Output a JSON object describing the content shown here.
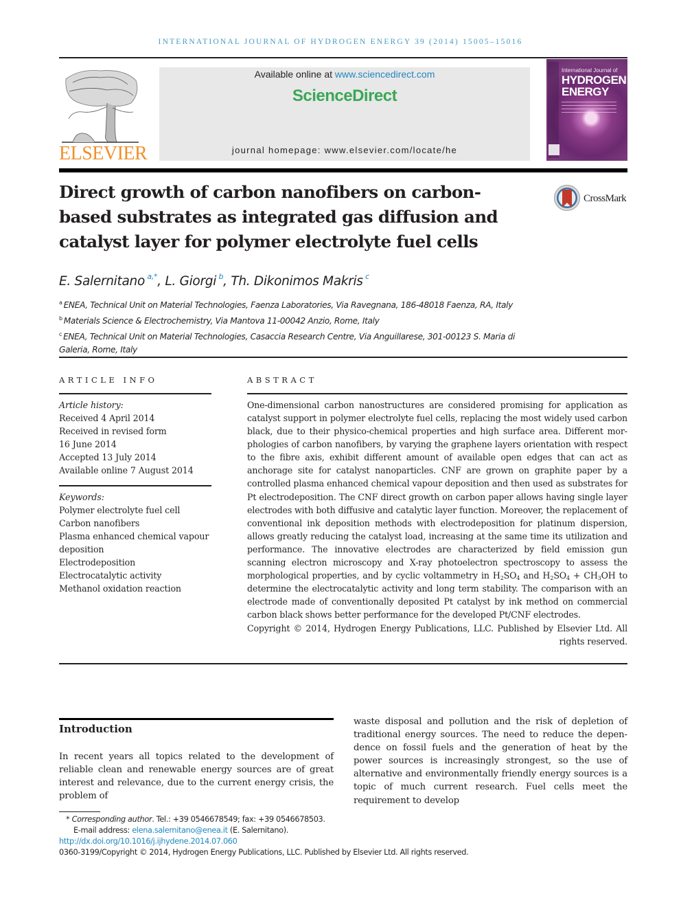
{
  "running_head": "INTERNATIONAL JOURNAL OF HYDROGEN ENERGY 39 (2014) 15005–15016",
  "header": {
    "publisher_name": "ELSEVIER",
    "available_online_prefix": "Available online at ",
    "available_online_link": "www.sciencedirect.com",
    "brand": "ScienceDirect",
    "journal_homepage": "journal homepage: www.elsevier.com/locate/he",
    "cover": {
      "line1": "International Journal of",
      "line2": "HYDROGEN",
      "line3": "ENERGY"
    }
  },
  "colors": {
    "link_blue": "#1f87c0",
    "running_head_blue": "#4a9bc0",
    "sciencedirect_green": "#3aa757",
    "elsevier_orange": "#f0902a"
  },
  "article": {
    "title": "Direct growth of carbon nanofibers on carbon-based substrates as integrated gas diffusion and catalyst layer for polymer electrolyte fuel cells",
    "crossmark_label": "CrossMark",
    "authors": [
      {
        "name": "E. Salernitano",
        "marks": "a,*"
      },
      {
        "name": "L. Giorgi",
        "marks": "b"
      },
      {
        "name": "Th. Dikonimos Makris",
        "marks": "c"
      }
    ],
    "affiliations": [
      {
        "mark": "a",
        "text": "ENEA, Technical Unit on Material Technologies, Faenza Laboratories, Via Ravegnana, 186-48018 Faenza, RA, Italy"
      },
      {
        "mark": "b",
        "text": "Materials Science & Electrochemistry, Via Mantova 11-00042 Anzio, Rome, Italy"
      },
      {
        "mark": "c",
        "text": "ENEA, Technical Unit on Material Technologies, Casaccia Research Centre, Via Anguillarese, 301-00123 S. Maria di Galeria, Rome, Italy"
      }
    ]
  },
  "article_info": {
    "heading": "ARTICLE INFO",
    "history_label": "Article history:",
    "history": [
      "Received 4 April 2014",
      "Received in revised form",
      "16 June 2014",
      "Accepted 13 July 2014",
      "Available online 7 August 2014"
    ],
    "keywords_label": "Keywords:",
    "keywords": [
      "Polymer electrolyte fuel cell",
      "Carbon nanofibers",
      "Plasma enhanced chemical vapour deposition",
      "Electrodeposition",
      "Electrocatalytic activity",
      "Methanol oxidation reaction"
    ]
  },
  "abstract": {
    "heading": "ABSTRACT",
    "part1": "One-dimensional carbon nanostructures are considered promising for application as catalyst support in polymer electrolyte fuel cells, replacing the most widely used carbon black, due to their physico-chemical properties and high surface area. Different mor­phologies of carbon nanofibers, by varying the graphene layers orientation with respect to the fibre axis, exhibit different amount of available open edges that can act as anchorage site for catalyst nanoparticles. CNF are grown on graphite paper by a controlled plasma enhanced chemical vapour deposition and then used as substrates for Pt electrodeposition. The CNF direct growth on carbon paper allows having single layer electrodes with both diffusive and catalytic layer function. Moreover, the replacement of conventional ink deposition methods with electrodeposition for platinum dispersion, allows greatly reducing the catalyst load, increasing at the same time its utilization and performance. The innovative electrodes are characterized by field emission gun scanning electron micro­scopy and X-ray photoelectron spectroscopy to assess the morphological properties, and by cyclic voltammetry in ",
    "formula1": {
      "a": "H",
      "a_sub": "2",
      "b": "SO",
      "b_sub": "4"
    },
    "part2": " and ",
    "formula2": {
      "a": "H",
      "a_sub": "2",
      "b": "SO",
      "b_sub": "4",
      "plus": " + CH",
      "c_sub": "3",
      "d": "OH"
    },
    "part3": " to determine the electrocatalytic activity and long term stability. The comparison with an electrode made of conventionally deposited Pt catalyst by ink method on commercial carbon black shows better performance for the developed Pt/CNF electrodes.",
    "copyright": "Copyright © 2014, Hydrogen Energy Publications, LLC. Published by Elsevier Ltd. All rights reserved."
  },
  "introduction": {
    "heading": "Introduction",
    "col1": "In recent years all topics related to the development of reliable clean and renewable energy sources are of great interest and relevance, due to the current energy crisis, the problem of",
    "col2": "waste disposal and pollution and the risk of depletion of traditional energy sources. The need to reduce the depen­dence on fossil fuels and the generation of heat by the power sources is increasingly strongest, so the use of alternative and environmentally friendly energy sources is a topic of much current research. Fuel cells meet the requirement to develop"
  },
  "footnotes": {
    "star": "*",
    "corresponding_label": "Corresponding author",
    "contact": ". Tel.: +39 0546678549; fax: +39 0546678503.",
    "email_label": "E-mail address: ",
    "email": "elena.salernitano@enea.it",
    "email_suffix": " (E. Salernitano).",
    "doi": "http://dx.doi.org/10.1016/j.ijhydene.2014.07.060",
    "issn_copyright": "0360-3199/Copyright © 2014, Hydrogen Energy Publications, LLC. Published by Elsevier Ltd. All rights reserved."
  }
}
